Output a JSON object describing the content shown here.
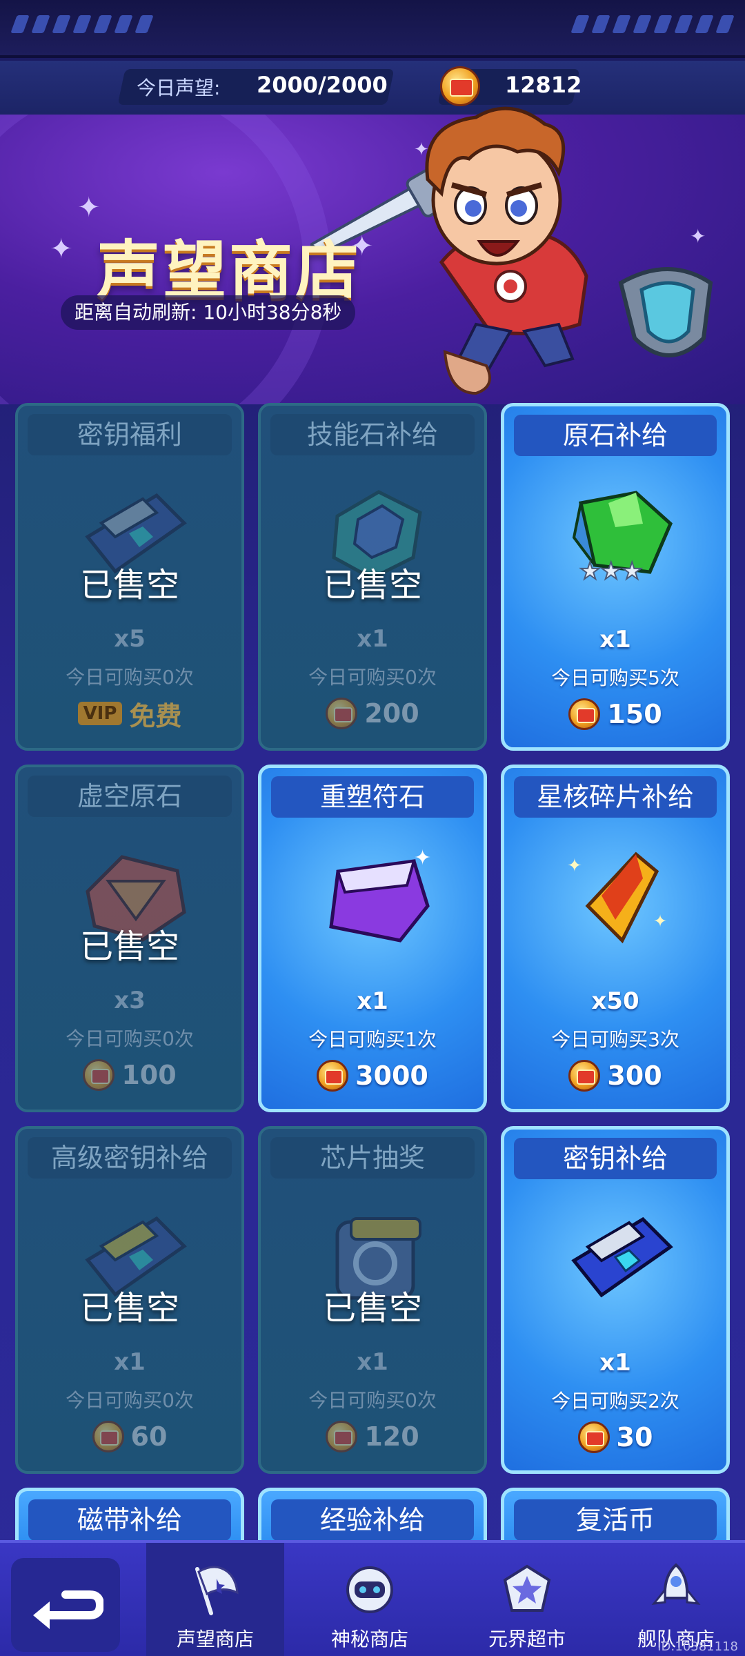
{
  "resources": {
    "reputation_label": "今日声望:",
    "reputation_value": "2000/2000",
    "coins_value": "12812"
  },
  "banner": {
    "title": "声望商店",
    "refresh_text": "距离自动刷新: 10小时38分8秒"
  },
  "sold_out_label": "已售空",
  "cards": [
    {
      "title": "密钥福利",
      "qty": "x5",
      "limit": "今日可购买0次",
      "price": "免费",
      "vip": "VIP",
      "status": "sold_out",
      "icon": "key-card-icon"
    },
    {
      "title": "技能石补给",
      "qty": "x1",
      "limit": "今日可购买0次",
      "price": "200",
      "status": "sold_out",
      "icon": "skill-stone-icon"
    },
    {
      "title": "原石补给",
      "qty": "x1",
      "limit": "今日可购买5次",
      "price": "150",
      "status": "available",
      "icon": "green-gem-icon"
    },
    {
      "title": "虚空原石",
      "qty": "x3",
      "limit": "今日可购买0次",
      "price": "100",
      "status": "sold_out",
      "icon": "void-stone-icon"
    },
    {
      "title": "重塑符石",
      "qty": "x1",
      "limit": "今日可购买1次",
      "price": "3000",
      "status": "available",
      "icon": "purple-rune-icon"
    },
    {
      "title": "星核碎片补给",
      "qty": "x50",
      "limit": "今日可购买3次",
      "price": "300",
      "status": "available",
      "icon": "star-core-shard-icon"
    },
    {
      "title": "高级密钥补给",
      "qty": "x1",
      "limit": "今日可购买0次",
      "price": "60",
      "status": "sold_out",
      "icon": "gold-key-card-icon"
    },
    {
      "title": "芯片抽奖",
      "qty": "x1",
      "limit": "今日可购买0次",
      "price": "120",
      "status": "sold_out",
      "icon": "chip-icon"
    },
    {
      "title": "密钥补给",
      "qty": "x1",
      "limit": "今日可购买2次",
      "price": "30",
      "status": "available",
      "icon": "blue-key-card-icon"
    }
  ],
  "peek_cards": [
    {
      "title": "磁带补给"
    },
    {
      "title": "经验补给"
    },
    {
      "title": "复活币"
    }
  ],
  "nav": {
    "tabs": [
      {
        "label": "声望商店",
        "icon": "flag-icon",
        "active": true
      },
      {
        "label": "神秘商店",
        "icon": "robot-icon",
        "active": false
      },
      {
        "label": "元界超市",
        "icon": "star-badge-icon",
        "active": false
      },
      {
        "label": "舰队商店",
        "icon": "rocket-icon",
        "active": false
      }
    ],
    "uid": "ID:10381118"
  }
}
